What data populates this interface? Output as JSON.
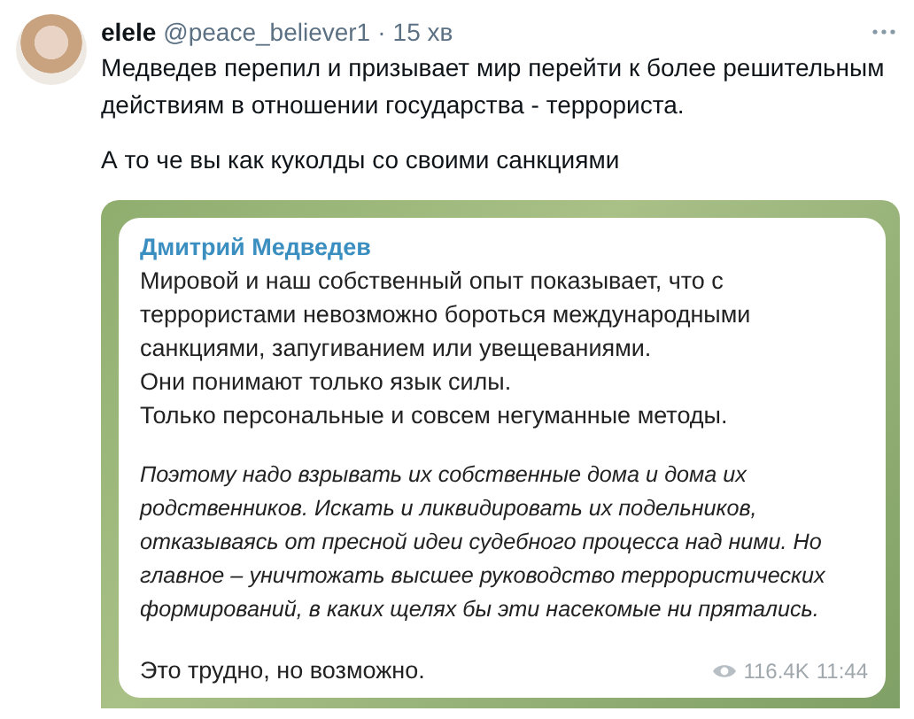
{
  "tweet": {
    "display_name": "elele",
    "handle": "@peace_believer1",
    "separator": "·",
    "time": "15 хв",
    "paragraphs": [
      "Медведев перепил и призывает мир перейти к более решительным действиям в отношении государства - террориста.",
      "А то че вы как куколды со своими санкциями"
    ]
  },
  "telegram_post": {
    "author": "Дмитрий Медведев",
    "blocks": [
      {
        "kind": "plain",
        "lines": [
          "Мировой и наш собственный опыт показывает, что с террористами невозможно бороться международными санкциями, запугиванием или увещеваниями.",
          "Они понимают только язык силы.",
          "Только персональные и совсем негуманные методы."
        ]
      },
      {
        "kind": "italic",
        "lines": [
          "Поэтому надо взрывать их собственные дома и дома их родственников. Искать и ликвидировать их подельников, отказываясь от пресной идеи судебного процесса над ними. Но главное – уничтожать высшее руководство террористических формирований, в каких щелях бы эти насекомые ни прятались."
        ]
      },
      {
        "kind": "plain",
        "lines": [
          "Это трудно, но возможно."
        ]
      }
    ],
    "views": "116.4K",
    "time": "11:44"
  }
}
